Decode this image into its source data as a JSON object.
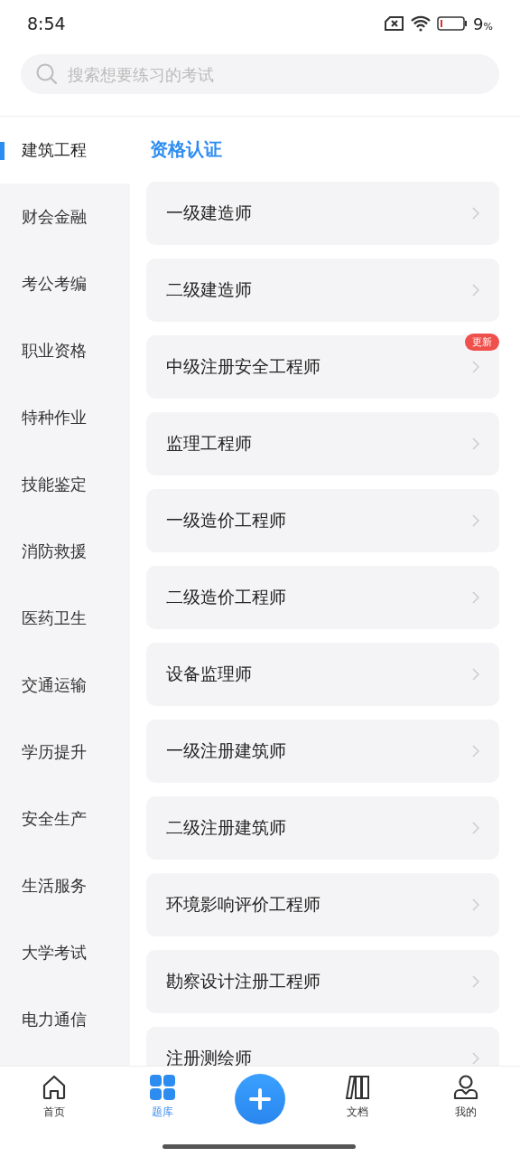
{
  "status_bar": {
    "time": "8:54",
    "battery": "9",
    "battery_unit": "%"
  },
  "search": {
    "placeholder": "搜索想要练习的考试"
  },
  "sidebar": {
    "items": [
      {
        "label": "建筑工程",
        "selected": true
      },
      {
        "label": "财会金融",
        "selected": false
      },
      {
        "label": "考公考编",
        "selected": false
      },
      {
        "label": "职业资格",
        "selected": false
      },
      {
        "label": "特种作业",
        "selected": false
      },
      {
        "label": "技能鉴定",
        "selected": false
      },
      {
        "label": "消防救援",
        "selected": false
      },
      {
        "label": "医药卫生",
        "selected": false
      },
      {
        "label": "交通运输",
        "selected": false
      },
      {
        "label": "学历提升",
        "selected": false
      },
      {
        "label": "安全生产",
        "selected": false
      },
      {
        "label": "生活服务",
        "selected": false
      },
      {
        "label": "大学考试",
        "selected": false
      },
      {
        "label": "电力通信",
        "selected": false
      }
    ]
  },
  "section": {
    "title": "资格认证",
    "items": [
      {
        "label": "一级建造师"
      },
      {
        "label": "二级建造师"
      },
      {
        "label": "中级注册安全工程师",
        "badge": "更新"
      },
      {
        "label": "监理工程师"
      },
      {
        "label": "一级造价工程师"
      },
      {
        "label": "二级造价工程师"
      },
      {
        "label": "设备监理师"
      },
      {
        "label": "一级注册建筑师"
      },
      {
        "label": "二级注册建筑师"
      },
      {
        "label": "环境影响评价工程师"
      },
      {
        "label": "勘察设计注册工程师"
      },
      {
        "label": "注册测绘师"
      }
    ]
  },
  "tab_bar": {
    "items": [
      {
        "label": "首页",
        "kind": "home",
        "selected": false
      },
      {
        "label": "题库",
        "kind": "grid",
        "selected": true
      },
      {
        "kind": "add"
      },
      {
        "label": "文档",
        "kind": "docs",
        "selected": false
      },
      {
        "label": "我的",
        "kind": "user",
        "selected": false
      }
    ]
  }
}
